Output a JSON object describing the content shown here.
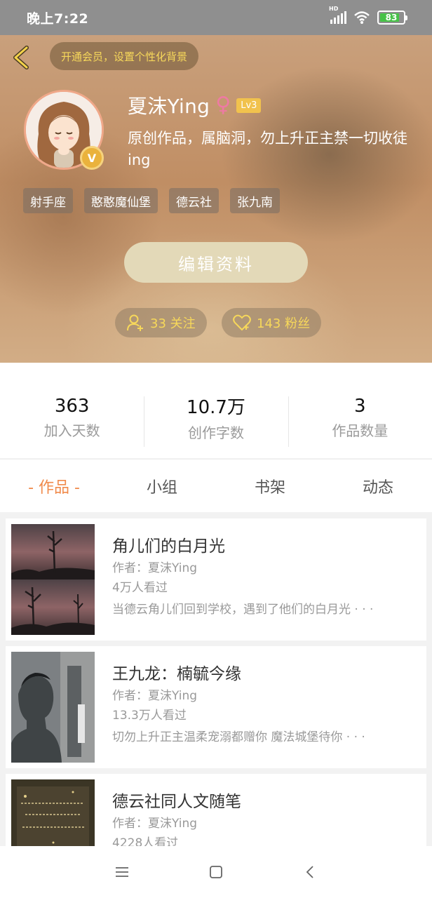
{
  "status_bar": {
    "time": "晚上7:22",
    "network": "HD",
    "battery": "83",
    "battery_level": 0.83
  },
  "header": {
    "vip_banner": "开通会员，设置个性化背景",
    "name": "夏沫Ying",
    "gender_symbol": "♀",
    "level": "Lv3",
    "verified_badge": "V",
    "bio": "原创作品，属脑洞，勿上升正主禁一切收徒ing",
    "tags": [
      "射手座",
      "憨憨魔仙堡",
      "德云社",
      "张九南"
    ],
    "edit_button": "编辑资料",
    "following": "33 关注",
    "fans": "143 粉丝"
  },
  "stats": [
    {
      "value": "363",
      "label": "加入天数"
    },
    {
      "value": "10.7万",
      "label": "创作字数"
    },
    {
      "value": "3",
      "label": "作品数量"
    }
  ],
  "tabs": [
    "- 作品 -",
    "小组",
    "书架",
    "动态"
  ],
  "active_tab": 0,
  "works": [
    {
      "title": "角儿们的白月光",
      "author": "作者：夏沫Ying",
      "views": "4万人看过",
      "desc": "当德云角儿们回到学校，遇到了他们的白月光 · · ·"
    },
    {
      "title": "王九龙：楠毓今缘",
      "author": "作者：夏沫Ying",
      "views": "13.3万人看过",
      "desc": "切勿上升正主温柔宠溺都赠你 魔法城堡待你 · · ·"
    },
    {
      "title": "德云社同人文随笔",
      "author": "作者：夏沫Ying",
      "views": "4228人看过",
      "desc": ""
    }
  ],
  "colors": {
    "accent": "#f08a4b",
    "vip_text": "#f7d85a",
    "gender": "#ee7aa3",
    "level_badge": "#f1c24d"
  }
}
